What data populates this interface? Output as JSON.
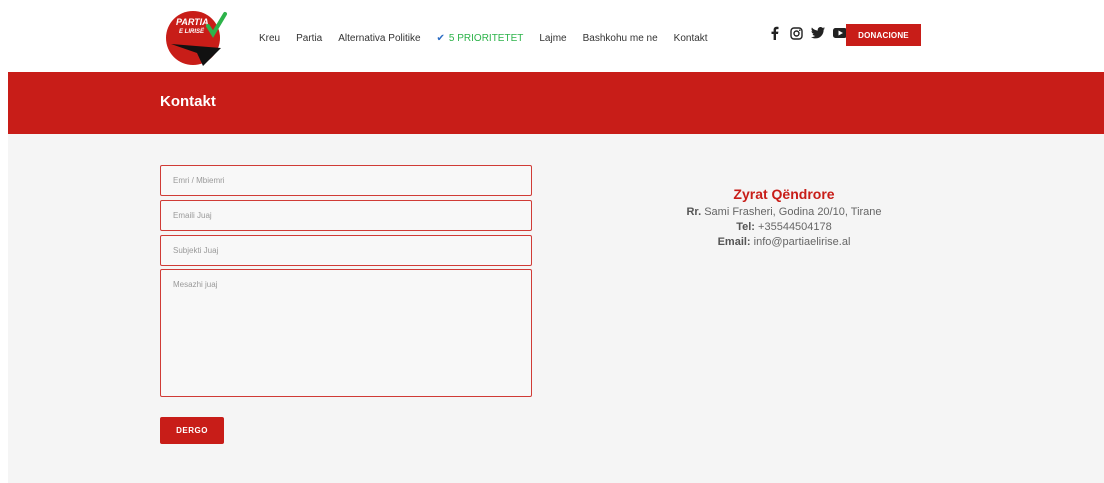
{
  "logo": {
    "text_line1": "PARTIA",
    "text_line2": "E LIRISË",
    "colors": {
      "red": "#c81d18",
      "black": "#111111",
      "green": "#2db34a"
    }
  },
  "nav": {
    "items": [
      {
        "label": "Kreu"
      },
      {
        "label": "Partia"
      },
      {
        "label": "Alternativa Politike"
      },
      {
        "label": "5 PRIORITETET",
        "icon": "check-icon"
      },
      {
        "label": "Lajme"
      },
      {
        "label": "Bashkohu me ne"
      },
      {
        "label": "Kontakt"
      }
    ],
    "social": [
      "facebook-icon",
      "instagram-icon",
      "twitter-icon",
      "youtube-icon"
    ],
    "donate_label": "DONACIONE"
  },
  "banner": {
    "title": "Kontakt"
  },
  "form": {
    "name_placeholder": "Emri / Mbiemri",
    "email_placeholder": "Emaili Juaj",
    "subject_placeholder": "Subjekti Juaj",
    "message_placeholder": "Mesazhi juaj",
    "submit_label": "DERGO"
  },
  "office": {
    "title": "Zyrat Qëndrore",
    "address_label": "Rr.",
    "address": "Sami Frasheri, Godina 20/10, Tirane",
    "tel_label": "Tel:",
    "tel": "+35544504178",
    "email_label": "Email:",
    "email": "info@partiaelirise.al"
  },
  "colors": {
    "accent": "#c81d18",
    "highlight": "#2db34a",
    "background": "#f5f5f5"
  }
}
